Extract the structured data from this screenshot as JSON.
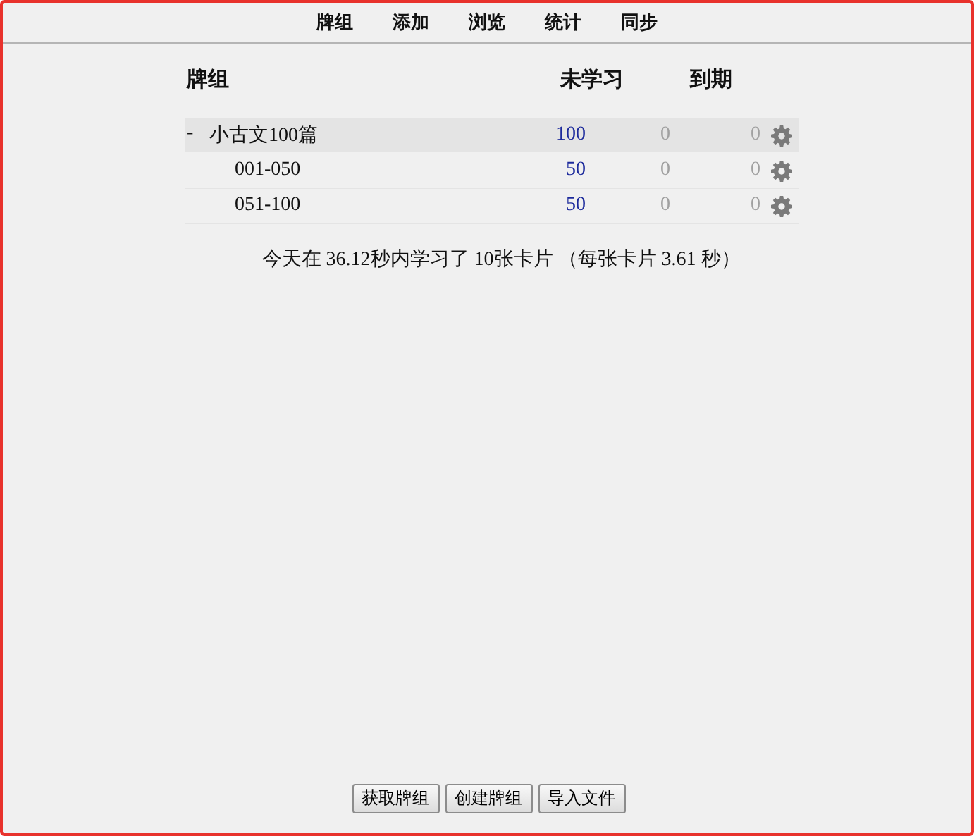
{
  "toolbar": [
    "牌组",
    "添加",
    "浏览",
    "统计",
    "同步"
  ],
  "table": {
    "columns": [
      "牌组",
      "未学习",
      "到期"
    ],
    "decks": [
      {
        "name": "小古文100篇",
        "expander": "-",
        "selected": true,
        "new": "100",
        "learn": "0",
        "due": "0",
        "children": [
          {
            "name": "001-050",
            "selected": false,
            "new": "50",
            "learn": "0",
            "due": "0"
          },
          {
            "name": "051-100",
            "selected": false,
            "new": "50",
            "learn": "0",
            "due": "0"
          }
        ]
      }
    ]
  },
  "stats": "今天在 36.12秒内学习了 10张卡片 （每张卡片 3.61 秒）",
  "buttons": [
    "获取牌组",
    "创建牌组",
    "导入文件"
  ]
}
